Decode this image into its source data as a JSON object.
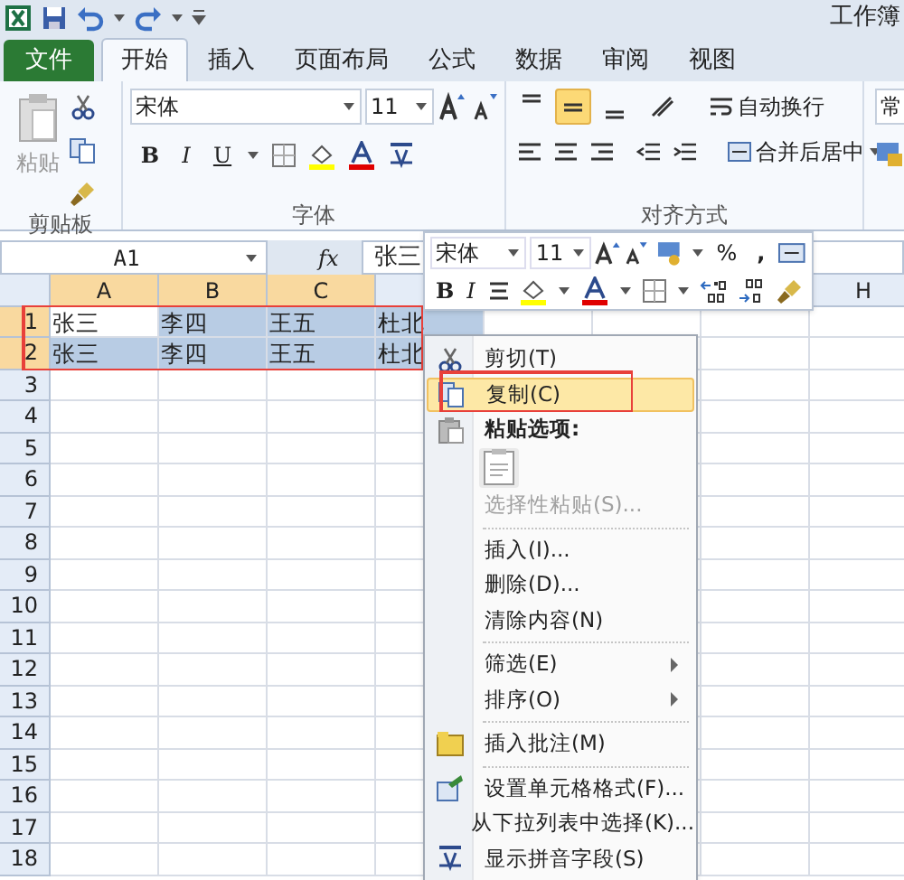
{
  "window": {
    "title": "工作簿"
  },
  "tabs": [
    {
      "label": "文件",
      "kind": "file",
      "selected": false
    },
    {
      "label": "开始",
      "kind": "tab",
      "selected": true
    },
    {
      "label": "插入",
      "kind": "tab",
      "selected": false
    },
    {
      "label": "页面布局",
      "kind": "tab",
      "selected": false
    },
    {
      "label": "公式",
      "kind": "tab",
      "selected": false
    },
    {
      "label": "数据",
      "kind": "tab",
      "selected": false
    },
    {
      "label": "审阅",
      "kind": "tab",
      "selected": false
    },
    {
      "label": "视图",
      "kind": "tab",
      "selected": false
    }
  ],
  "ribbon": {
    "clipboard": {
      "label": "剪贴板",
      "paste": "粘贴"
    },
    "font": {
      "label": "字体",
      "font_name": "宋体",
      "font_size": "11",
      "bold": "B",
      "italic": "I",
      "underline": "U"
    },
    "alignment": {
      "label": "对齐方式",
      "vertical_align": [
        {
          "selected": false
        },
        {
          "selected": true
        },
        {
          "selected": false
        }
      ],
      "wrap_text": "自动换行",
      "merge_center": "合并后居中"
    },
    "number": {
      "format": "常"
    }
  },
  "formula_bar": {
    "name_box": "A1",
    "fx": "fx",
    "value": "张三"
  },
  "sheet": {
    "columns": [
      {
        "label": "A",
        "selected": true
      },
      {
        "label": "B",
        "selected": true
      },
      {
        "label": "C",
        "selected": true
      },
      {
        "label": "H",
        "selected": false
      }
    ],
    "rows": [
      {
        "label": "1",
        "selected": true,
        "cells": [
          {
            "text": "张三",
            "selected": false
          },
          {
            "text": "李四",
            "selected": true
          },
          {
            "text": "王五",
            "selected": true
          },
          {
            "text": "杜北",
            "selected": true
          }
        ]
      },
      {
        "label": "2",
        "selected": true,
        "cells": [
          {
            "text": "张三",
            "selected": true
          },
          {
            "text": "李四",
            "selected": true
          },
          {
            "text": "王五",
            "selected": true
          },
          {
            "text": "杜北",
            "selected": true
          }
        ]
      },
      {
        "label": "3",
        "selected": false
      },
      {
        "label": "4",
        "selected": false
      },
      {
        "label": "5",
        "selected": false
      },
      {
        "label": "6",
        "selected": false
      },
      {
        "label": "7",
        "selected": false
      },
      {
        "label": "8",
        "selected": false
      },
      {
        "label": "9",
        "selected": false
      },
      {
        "label": "10",
        "selected": false
      },
      {
        "label": "11",
        "selected": false
      },
      {
        "label": "12",
        "selected": false
      },
      {
        "label": "13",
        "selected": false
      },
      {
        "label": "14",
        "selected": false
      },
      {
        "label": "15",
        "selected": false
      },
      {
        "label": "16",
        "selected": false
      },
      {
        "label": "17",
        "selected": false
      },
      {
        "label": "18",
        "selected": false
      }
    ]
  },
  "mini_toolbar": {
    "font_name": "宋体",
    "font_size": "11",
    "percent": "%",
    "comma": ",",
    "bold": "B",
    "italic": "I"
  },
  "context_menu": [
    {
      "kind": "item",
      "label": "剪切(T)",
      "highlighted": false,
      "disabled": false,
      "submenu": false
    },
    {
      "kind": "item",
      "label": "复制(C)",
      "highlighted": true,
      "disabled": false,
      "submenu": false
    },
    {
      "kind": "header",
      "label": "粘贴选项:"
    },
    {
      "kind": "paste-option"
    },
    {
      "kind": "item",
      "label": "选择性粘贴(S)...",
      "highlighted": false,
      "disabled": true,
      "submenu": false
    },
    {
      "kind": "separator"
    },
    {
      "kind": "item",
      "label": "插入(I)...",
      "highlighted": false,
      "disabled": false,
      "submenu": false
    },
    {
      "kind": "item",
      "label": "删除(D)...",
      "highlighted": false,
      "disabled": false,
      "submenu": false
    },
    {
      "kind": "item",
      "label": "清除内容(N)",
      "highlighted": false,
      "disabled": false,
      "submenu": false
    },
    {
      "kind": "separator"
    },
    {
      "kind": "item",
      "label": "筛选(E)",
      "highlighted": false,
      "disabled": false,
      "submenu": true
    },
    {
      "kind": "item",
      "label": "排序(O)",
      "highlighted": false,
      "disabled": false,
      "submenu": true
    },
    {
      "kind": "separator"
    },
    {
      "kind": "item",
      "label": "插入批注(M)",
      "highlighted": false,
      "disabled": false,
      "submenu": false
    },
    {
      "kind": "separator"
    },
    {
      "kind": "item",
      "label": "设置单元格格式(F)...",
      "highlighted": false,
      "disabled": false,
      "submenu": false
    },
    {
      "kind": "item",
      "label": "从下拉列表中选择(K)...",
      "highlighted": false,
      "disabled": false,
      "submenu": false
    },
    {
      "kind": "item",
      "label": "显示拼音字段(S)",
      "highlighted": false,
      "disabled": false,
      "submenu": false
    }
  ]
}
